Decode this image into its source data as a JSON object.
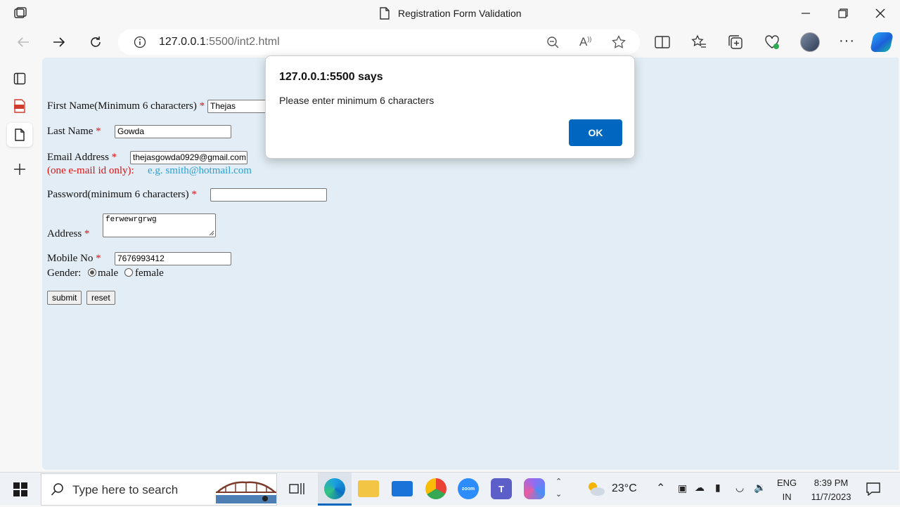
{
  "window": {
    "title": "Registration Form Validation"
  },
  "addressbar": {
    "url_host": "127.0.0.1",
    "url_rest": ":5500/int2.html"
  },
  "form": {
    "first_name_label": "First Name(Minimum 6 characters)",
    "first_name_value": "Thejas",
    "last_name_label": "Last Name",
    "last_name_value": "Gowda",
    "email_label": "Email Address",
    "email_value": "thejasgowda0929@gmail.com",
    "email_note": "(one e-mail id only):",
    "email_example": "e.g. smith@hotmail.com",
    "password_label": "Password(minimum 6 characters)",
    "password_value": "",
    "address_label": "Address",
    "address_value": "ferwewrgrwg",
    "mobile_label": "Mobile No",
    "mobile_value": "7676993412",
    "gender_label": "Gender:",
    "gender_options": [
      "male",
      "female"
    ],
    "gender_selected": "male",
    "required_mark": "*",
    "submit_label": "submit",
    "reset_label": "reset"
  },
  "dialog": {
    "title": "127.0.0.1:5500 says",
    "message": "Please enter minimum 6 characters",
    "ok_label": "OK"
  },
  "taskbar": {
    "search_placeholder": "Type here to search",
    "weather": "23°C",
    "lang_top": "ENG",
    "lang_bottom": "IN",
    "time": "8:39 PM",
    "date": "11/7/2023",
    "zoom_label": "zoom"
  },
  "colors": {
    "accent": "#0067c0",
    "required": "#e01010",
    "example_link": "#2a9fd6",
    "content_bg": "#e2edf5"
  }
}
